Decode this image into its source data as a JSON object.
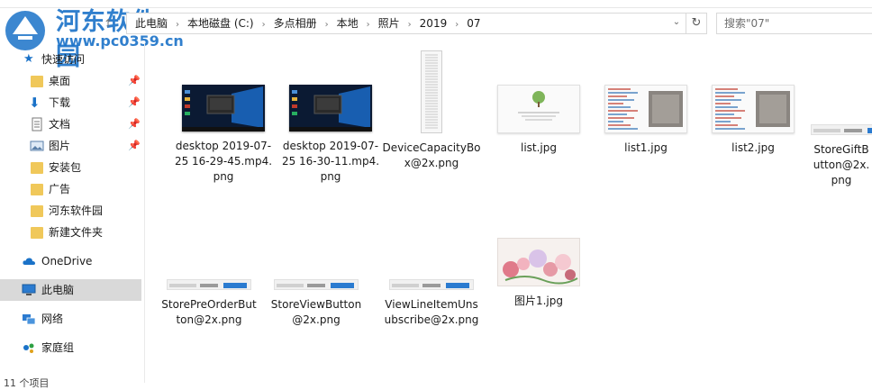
{
  "window": {
    "address_crumbs": [
      "此电脑",
      "本地磁盘 (C:)",
      "多点相册",
      "本地",
      "照片",
      "2019",
      "07"
    ],
    "search_placeholder": "搜索\"07\"",
    "watermark_title": "河东软件园",
    "watermark_url": "www.pc0359.cn"
  },
  "nav": {
    "quick_access": "快速访问",
    "items": [
      {
        "label": "桌面",
        "icon": "desktop-folder-icon",
        "pinned": true
      },
      {
        "label": "下载",
        "icon": "download-icon",
        "pinned": true
      },
      {
        "label": "文档",
        "icon": "document-icon",
        "pinned": true
      },
      {
        "label": "图片",
        "icon": "picture-icon",
        "pinned": true
      },
      {
        "label": "安装包",
        "icon": "folder-icon",
        "pinned": false
      },
      {
        "label": "广告",
        "icon": "folder-icon",
        "pinned": false
      },
      {
        "label": "河东软件园",
        "icon": "folder-icon",
        "pinned": false
      },
      {
        "label": "新建文件夹",
        "icon": "folder-icon",
        "pinned": false
      }
    ],
    "onedrive": "OneDrive",
    "this_pc": "此电脑",
    "network": "网络",
    "homegroup": "家庭组",
    "pin_glyph": "📌"
  },
  "status_bar": {
    "count": "11 个项目"
  },
  "files": [
    {
      "name": "desktop 2019-07-25 16-29-45.mp4.png",
      "thumb": "desktop"
    },
    {
      "name": "desktop 2019-07-25 16-30-11.mp4.png",
      "thumb": "desktop"
    },
    {
      "name": "DeviceCapacityBox@2x.png",
      "thumb": "tall"
    },
    {
      "name": "list.jpg",
      "thumb": "tree"
    },
    {
      "name": "list1.jpg",
      "thumb": "code"
    },
    {
      "name": "list2.jpg",
      "thumb": "code"
    },
    {
      "name": "StoreGiftButton@2x.png",
      "thumb": "strip"
    },
    {
      "name": "StorePreOrderButton@2x.png",
      "thumb": "strip"
    },
    {
      "name": "StoreViewButton@2x.png",
      "thumb": "strip"
    },
    {
      "name": "ViewLineItemUnsubscribe@2x.png",
      "thumb": "strip"
    },
    {
      "name": "图片1.jpg",
      "thumb": "floral"
    }
  ],
  "colors": {
    "accent": "#1a72c8",
    "selected": "#d9d9d9",
    "folder": "#f0c85a"
  }
}
